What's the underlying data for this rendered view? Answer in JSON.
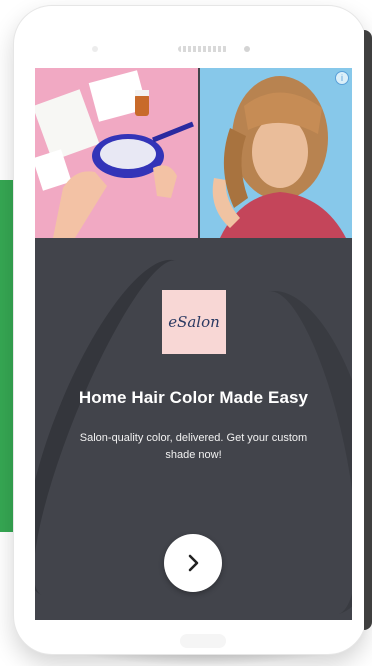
{
  "ad": {
    "brand_logo_text": "eSalon",
    "headline": "Home Hair Color Made Easy",
    "description": "Salon-quality color, delivered. Get your custom shade now!",
    "cta_icon": "chevron-right-icon",
    "info_icon_glyph": "i"
  },
  "colors": {
    "accent_green": "#36a853",
    "screen_background": "#42444b",
    "logo_background": "#f8d7d5",
    "photo_left_background": "#f1a9c3",
    "photo_right_background": "#87c8ea"
  }
}
